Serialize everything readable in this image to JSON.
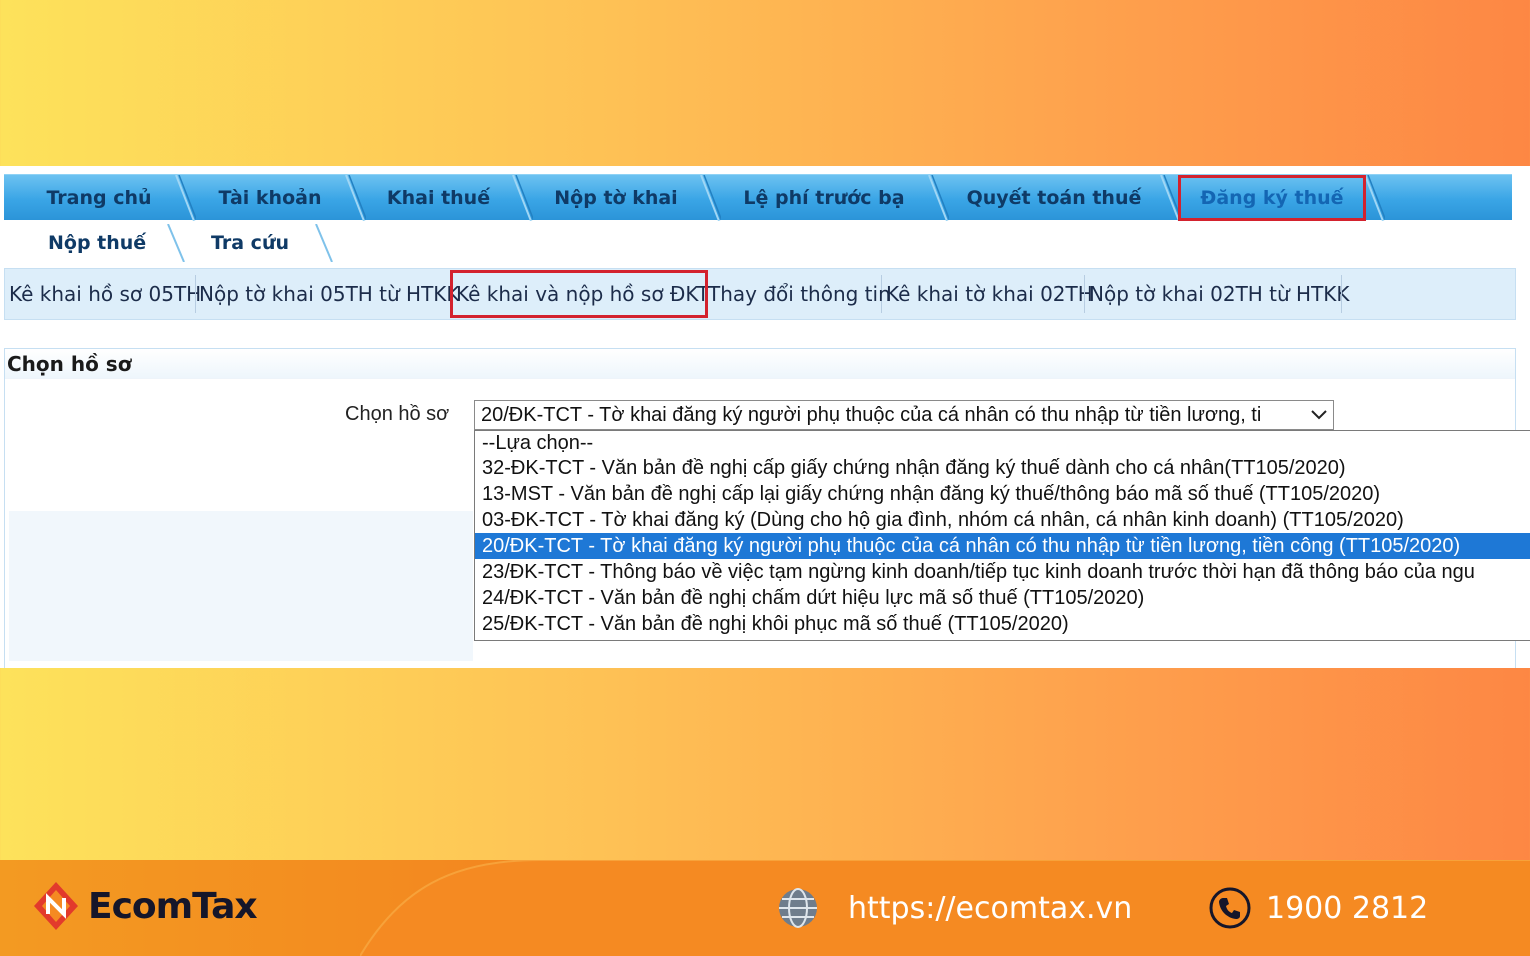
{
  "main_nav": {
    "tabs": [
      {
        "label": "Trang chủ"
      },
      {
        "label": "Tài khoản"
      },
      {
        "label": "Khai thuế"
      },
      {
        "label": "Nộp tờ khai"
      },
      {
        "label": "Lệ phí trước bạ"
      },
      {
        "label": "Quyết toán thuế"
      },
      {
        "label": "Đăng ký thuế",
        "active": true
      }
    ]
  },
  "sub_nav": {
    "tabs": [
      {
        "label": "Nộp thuế"
      },
      {
        "label": "Tra cứu"
      }
    ]
  },
  "function_bar": {
    "items": [
      {
        "label": "Kê khai hồ sơ 05TH"
      },
      {
        "label": "Nộp tờ khai 05TH từ HTKK"
      },
      {
        "label": "Kê khai và nộp hồ sơ ĐKT",
        "highlighted": true
      },
      {
        "label": "Thay đổi thông tin"
      },
      {
        "label": "Kê khai tờ khai 02TH"
      },
      {
        "label": "Nộp tờ khai 02TH từ HTKK"
      }
    ]
  },
  "section": {
    "title": "Chọn hồ sơ",
    "field_label": "Chọn hồ sơ",
    "selected_value": "20/ĐK-TCT - Tờ khai đăng ký người phụ thuộc của cá nhân có thu nhập từ tiền lương, ti",
    "options": [
      {
        "label": "--Lựa chọn--"
      },
      {
        "label": "32-ĐK-TCT - Văn bản đề nghị cấp giấy chứng nhận đăng ký thuế dành cho cá nhân(TT105/2020)"
      },
      {
        "label": "13-MST - Văn bản đề nghị cấp lại giấy chứng nhận đăng ký thuế/thông báo mã số thuế (TT105/2020)"
      },
      {
        "label": "03-ĐK-TCT - Tờ khai đăng ký (Dùng cho hộ gia đình, nhóm cá nhân, cá nhân kinh doanh) (TT105/2020)"
      },
      {
        "label": "20/ĐK-TCT - Tờ khai đăng ký người phụ thuộc của cá nhân có thu nhập từ tiền lương, tiền công (TT105/2020)",
        "selected": true
      },
      {
        "label": "23/ĐK-TCT - Thông báo về việc tạm ngừng kinh doanh/tiếp tục kinh doanh trước thời hạn đã thông báo của ngu"
      },
      {
        "label": "24/ĐK-TCT - Văn bản đề nghị chấm dứt hiệu lực mã số thuế (TT105/2020)"
      },
      {
        "label": "25/ĐK-TCT - Văn bản đề nghị khôi phục mã số thuế (TT105/2020)"
      }
    ]
  },
  "footer": {
    "brand": "EcomTax",
    "website": "https://ecomtax.vn",
    "phone": "1900 2812"
  },
  "colors": {
    "nav_blue": "#3aa5e6",
    "highlight_red": "#d3222e",
    "selected_option": "#1e78d6",
    "footer_orange": "#f3861f"
  },
  "icons": [
    "chevron-down-icon",
    "globe-icon",
    "phone-icon",
    "ecomtax-logo-icon"
  ]
}
